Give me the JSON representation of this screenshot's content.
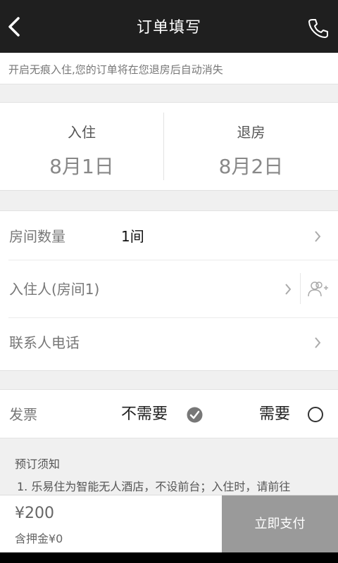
{
  "header": {
    "title": "订单填写",
    "back_icon": "back-arrow-icon",
    "phone_icon": "phone-icon"
  },
  "notice": "开启无痕入住,您的订单将在您退房后自动消失",
  "dates": {
    "checkin_label": "入住",
    "checkin_value": "8月1日",
    "checkout_label": "退房",
    "checkout_value": "8月2日"
  },
  "rows": {
    "room_count_label": "房间数量",
    "room_count_value": "1间",
    "guest_label": "入住人(房间1)",
    "phone_label": "联系人电话"
  },
  "invoice": {
    "label": "发票",
    "option_no": "不需要",
    "option_yes": "需要",
    "selected": "不需要"
  },
  "booking": {
    "title": "预订须知",
    "item1": "1. 乐易住为智能无人酒店，不设前台；入住时，请前往"
  },
  "footer": {
    "price": "¥200",
    "deposit": "含押金¥0",
    "pay_label": "立即支付"
  },
  "colors": {
    "header_bg": "#1f1f1f",
    "pay_button_bg": "#9a9a9a",
    "check_icon": "#777777"
  }
}
